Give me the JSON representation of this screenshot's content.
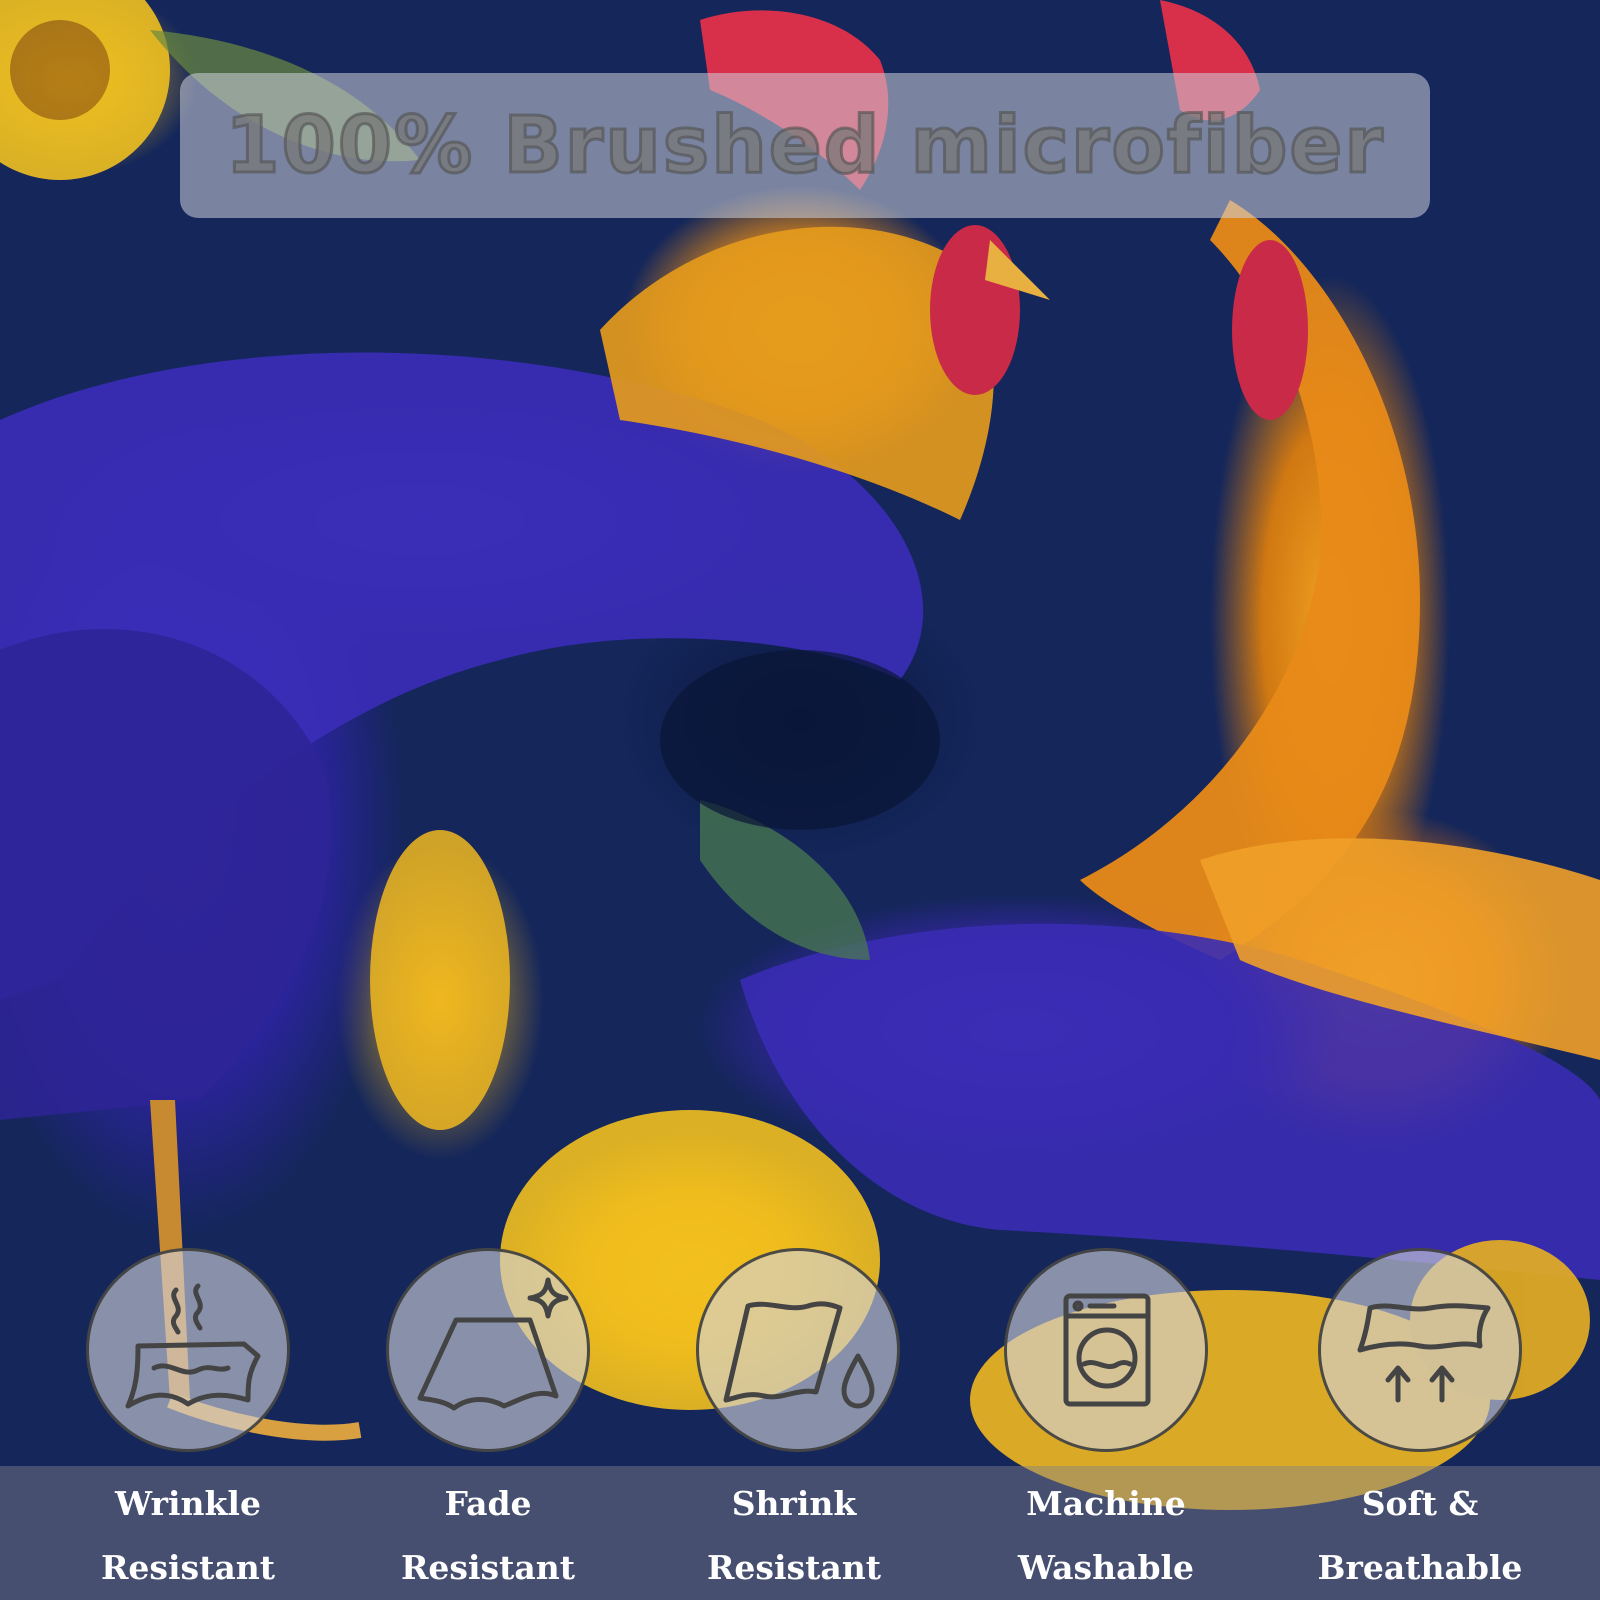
{
  "banner": {
    "title": "100% Brushed microfiber"
  },
  "features": [
    {
      "icon": "wrinkle-resistant-icon",
      "line1": "Wrinkle",
      "line2": "Resistant"
    },
    {
      "icon": "fade-resistant-icon",
      "line1": "Fade",
      "line2": "Resistant"
    },
    {
      "icon": "shrink-resistant-icon",
      "line1": "Shrink",
      "line2": "Resistant"
    },
    {
      "icon": "washing-machine-icon",
      "line1": "Machine",
      "line2": "Washable"
    },
    {
      "icon": "breathable-fabric-icon",
      "line1": "Soft &",
      "line2": "Breathable"
    }
  ],
  "colors": {
    "background": "#14265a",
    "feather_blue": "#3426a0",
    "feather_orange": "#e08a1a",
    "comb_red": "#d8304a",
    "sunflower_yellow": "#f0c020",
    "label_text": "#ffffff"
  }
}
